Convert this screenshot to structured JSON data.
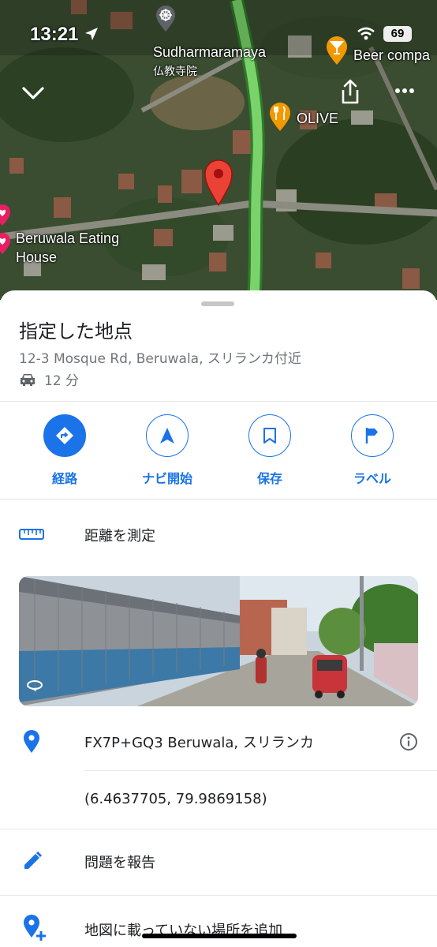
{
  "status_bar": {
    "time": "13:21",
    "battery": "69",
    "location_icon": "location-arrow-icon",
    "wifi_icon": "wifi-icon"
  },
  "map": {
    "labels": {
      "temple_name": "Sudharmaramaya",
      "temple_sub": "仏教寺院",
      "beer": "Beer compa",
      "olive": "OLIVE",
      "eating_house_line1": "Beruwala Eating",
      "eating_house_line2": "House"
    },
    "icons": [
      "chevron-down-icon",
      "share-icon",
      "more-icon",
      "pin-icon",
      "restaurant-icon",
      "bar-icon",
      "temple-icon"
    ],
    "colors": {
      "road": "#79d36a",
      "pin": "#ea4335",
      "poi_orange": "#f29900",
      "poi_pink": "#e91e63"
    }
  },
  "sheet": {
    "title": "指定した地点",
    "address": "12-3 Mosque Rd, Beruwala, スリランカ付近",
    "drive_time": "12 分",
    "actions": [
      {
        "label": "経路",
        "icon": "directions-icon"
      },
      {
        "label": "ナビ開始",
        "icon": "navigation-icon"
      },
      {
        "label": "保存",
        "icon": "bookmark-icon"
      },
      {
        "label": "ラベル",
        "icon": "flag-icon"
      }
    ],
    "measure_distance": "距離を測定",
    "plus_code": "FX7P+GQ3 Beruwala, スリランカ",
    "coordinates": "(6.4637705, 79.9869158)",
    "report_problem": "問題を報告",
    "add_missing_place": "地図に載っていない場所を追加"
  },
  "colors": {
    "accent": "#1a73e8",
    "text_primary": "#202124",
    "text_secondary": "#70757a"
  }
}
